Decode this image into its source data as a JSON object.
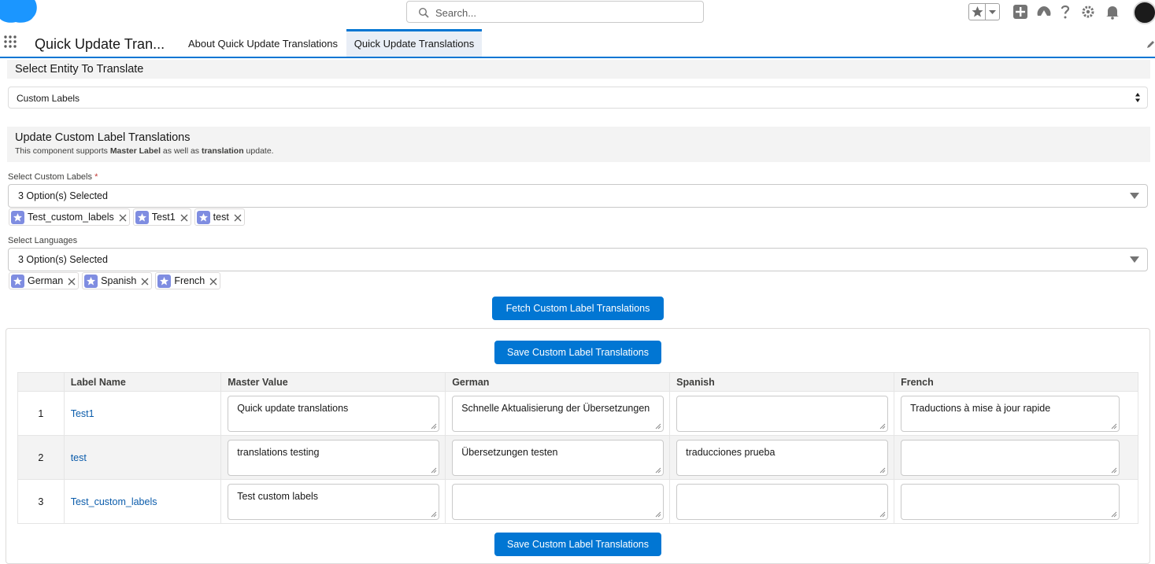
{
  "header": {
    "search_placeholder": "Search...",
    "brand_color": "#1b96ff",
    "accent_color": "#0176d3"
  },
  "nav": {
    "app_name": "Quick Update Tran...",
    "tabs": [
      {
        "label": "About Quick Update Translations",
        "active": false
      },
      {
        "label": "Quick Update Translations",
        "active": true
      }
    ]
  },
  "entity_section": {
    "title": "Select Entity To Translate",
    "selected": "Custom Labels"
  },
  "update_section": {
    "title": "Update Custom Label Translations",
    "desc_prefix": "This component supports ",
    "desc_bold1": "Master Label",
    "desc_mid": " as well as ",
    "desc_bold2": "translation",
    "desc_suffix": " update."
  },
  "labels_field": {
    "label": "Select Custom Labels",
    "required_mark": "*",
    "value": "3 Option(s) Selected",
    "pills": [
      "Test_custom_labels",
      "Test1",
      "test"
    ]
  },
  "languages_field": {
    "label": "Select Languages",
    "value": "3 Option(s) Selected",
    "pills": [
      "German",
      "Spanish",
      "French"
    ]
  },
  "buttons": {
    "fetch": "Fetch Custom Label Translations",
    "save": "Save Custom Label Translations"
  },
  "table": {
    "headers": [
      "",
      "Label Name",
      "Master Value",
      "German",
      "Spanish",
      "French"
    ],
    "rows": [
      {
        "num": "1",
        "label": "Test1",
        "master": "Quick update translations",
        "german": "Schnelle Aktualisierung der Übersetzungen",
        "spanish": "",
        "french": "Traductions à mise à jour rapide"
      },
      {
        "num": "2",
        "label": "test",
        "master": "translations testing",
        "german": "Übersetzungen testen",
        "spanish": "traducciones prueba",
        "french": ""
      },
      {
        "num": "3",
        "label": "Test_custom_labels",
        "master": "Test custom labels",
        "german": "",
        "spanish": "",
        "french": ""
      }
    ]
  }
}
